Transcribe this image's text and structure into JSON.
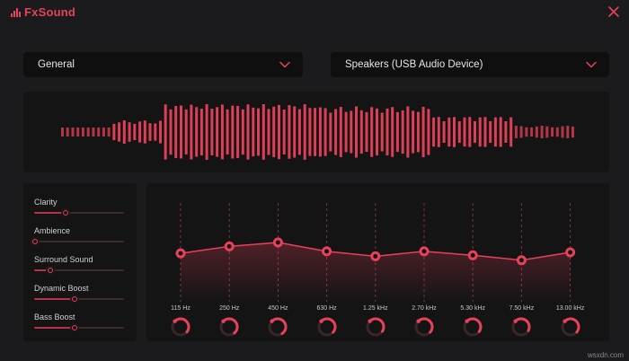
{
  "app": {
    "title": "FxSound"
  },
  "colors": {
    "accent": "#e8415a",
    "background": "#1b1b1d",
    "panel": "#141415",
    "dropdown": "#0f0f10"
  },
  "icons": {
    "close": "close-icon",
    "chevron": "chevron-down-icon",
    "logo": "fxsound-logo-icon"
  },
  "preset_dropdown": {
    "selected": "General"
  },
  "device_dropdown": {
    "selected": "Speakers (USB Audio Device)"
  },
  "effects": [
    {
      "name": "Clarity",
      "value": 0.35
    },
    {
      "name": "Ambience",
      "value": 0.0
    },
    {
      "name": "Surround Sound",
      "value": 0.18
    },
    {
      "name": "Dynamic Boost",
      "value": 0.45
    },
    {
      "name": "Bass Boost",
      "value": 0.45
    }
  ],
  "equalizer": {
    "bands": [
      {
        "label": "115 Hz",
        "level": 0.49
      },
      {
        "label": "250 Hz",
        "level": 0.56
      },
      {
        "label": "450 Hz",
        "level": 0.6
      },
      {
        "label": "630 Hz",
        "level": 0.51
      },
      {
        "label": "1.25 kHz",
        "level": 0.46
      },
      {
        "label": "2.70 kHz",
        "level": 0.51
      },
      {
        "label": "5.30 kHz",
        "level": 0.47
      },
      {
        "label": "7.50 kHz",
        "level": 0.42
      },
      {
        "label": "13.00 kHz",
        "level": 0.5
      }
    ]
  },
  "watermark": "wsxdn.com"
}
